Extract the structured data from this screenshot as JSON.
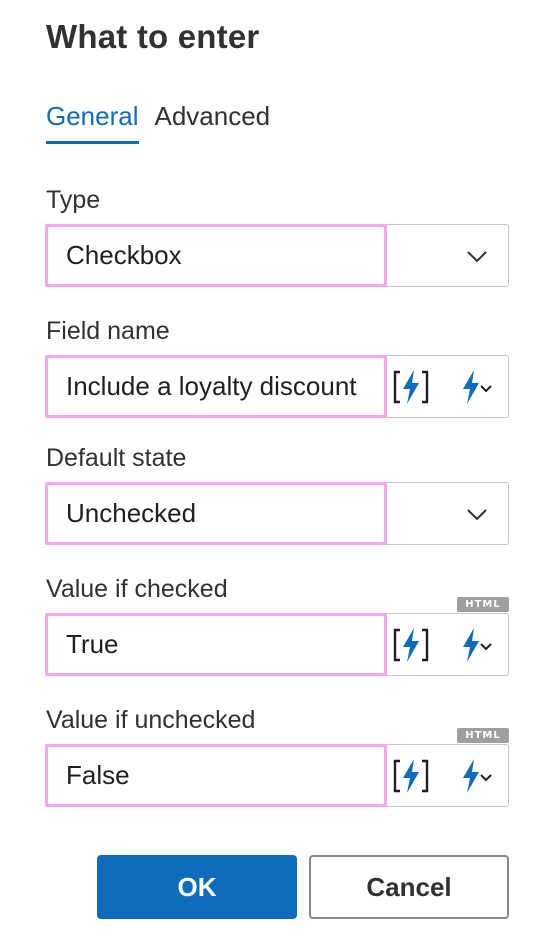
{
  "dialog": {
    "title": "What to enter"
  },
  "tabs": [
    {
      "label": "General",
      "active": true
    },
    {
      "label": "Advanced",
      "active": false
    }
  ],
  "fields": {
    "type": {
      "label": "Type",
      "value": "Checkbox"
    },
    "field_name": {
      "label": "Field name",
      "value": "Include a loyalty discount"
    },
    "default_state": {
      "label": "Default state",
      "value": "Unchecked"
    },
    "value_if_checked": {
      "label": "Value if checked",
      "value": "True",
      "badge": "HTML"
    },
    "value_if_unchecked": {
      "label": "Value if unchecked",
      "value": "False",
      "badge": "HTML"
    }
  },
  "buttons": {
    "ok": "OK",
    "cancel": "Cancel"
  },
  "icons": {
    "dropdown": "chevron-down-icon",
    "variable": "variable-bolt-icon",
    "bolt_menu": "bolt-menu-icon"
  },
  "colors": {
    "accent": "#0f6cbd",
    "highlight": "#f5a8f0",
    "border": "#c8c6c4",
    "badge": "#a19f9d"
  }
}
